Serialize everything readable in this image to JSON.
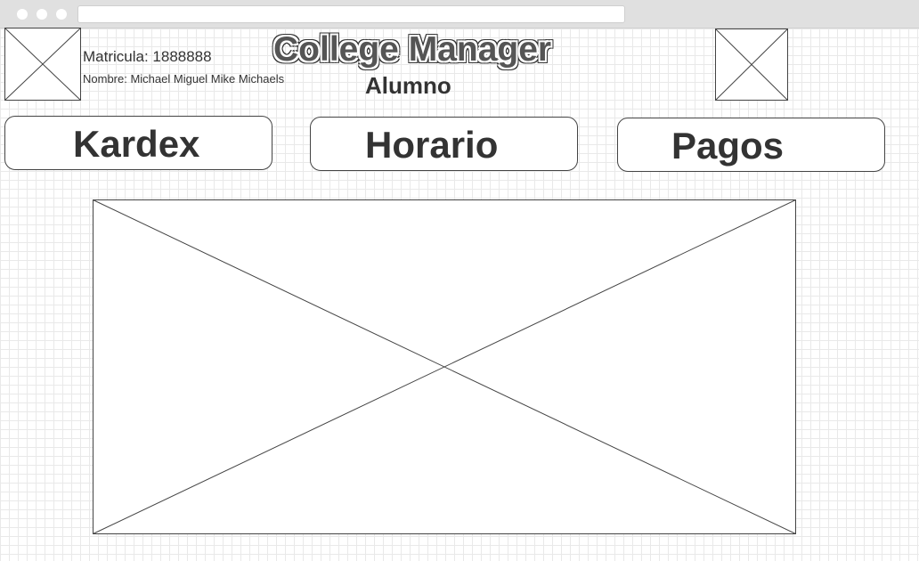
{
  "student": {
    "matricula": "Matricula: 1888888",
    "nombre": "Nombre: Michael Miguel Mike Michaels"
  },
  "header": {
    "title": "College Manager",
    "role": "Alumno"
  },
  "nav": {
    "kardex": "Kardex",
    "horario": "Horario",
    "pagos": "Pagos"
  }
}
